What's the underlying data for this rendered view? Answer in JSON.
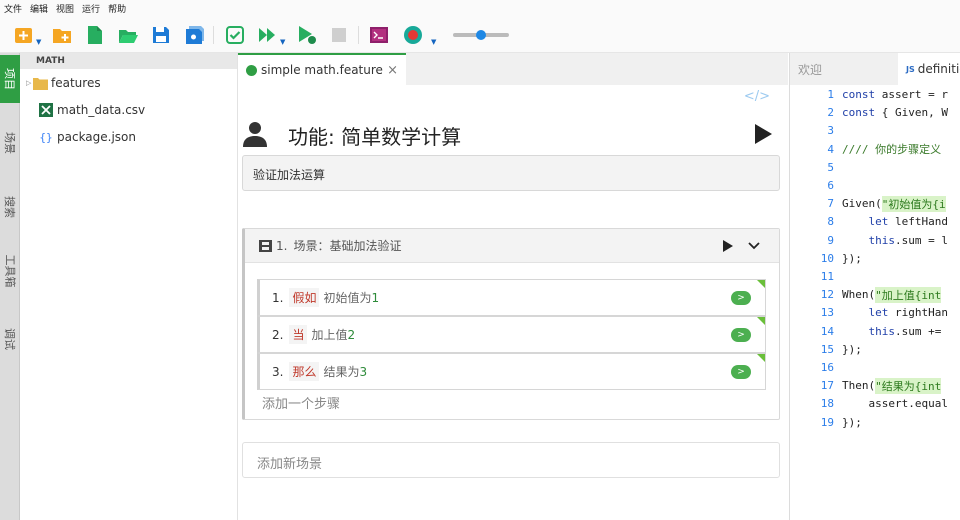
{
  "menu": [
    "文件",
    "编辑",
    "视图",
    "运行",
    "帮助"
  ],
  "toolbar": {
    "buttons": [
      "new-icon",
      "new-folder-icon",
      "new-file-icon",
      "open-folder-icon",
      "save-icon",
      "save-all-icon",
      "check-icon",
      "run-all-icon",
      "run-icon",
      "stop-icon",
      "terminal-icon",
      "record-icon"
    ],
    "slider_level": 0.5
  },
  "side_tabs": [
    "项目",
    "场景",
    "搜索",
    "工具箱",
    "调试"
  ],
  "explorer": {
    "title": "MATH",
    "items": [
      {
        "label": "features",
        "type": "folder"
      },
      {
        "label": "math_data.csv",
        "type": "excel"
      },
      {
        "label": "package.json",
        "type": "json"
      }
    ]
  },
  "editor_tab": {
    "label": "simple math.feature",
    "close": "×"
  },
  "code_toggle": "</>",
  "feature": {
    "title": "功能: 简单数学计算",
    "description": "验证加法运算"
  },
  "scenario": {
    "number": "1.",
    "title": "场景：基础加法验证",
    "steps": [
      {
        "num": "1.",
        "keyword": "假如",
        "text": "初始值为",
        "value": "1",
        "go": ">"
      },
      {
        "num": "2.",
        "keyword": "当",
        "text": "加上值",
        "value": "2",
        "go": ">"
      },
      {
        "num": "3.",
        "keyword": "那么",
        "text": "结果为",
        "value": "3",
        "go": ">"
      }
    ],
    "add_step": "添加一个步骤"
  },
  "add_scenario": "添加新场景",
  "right_tabs": {
    "welcome": "欢迎",
    "definitions_icon": "JS",
    "definitions": "definitions"
  },
  "code_lines": [
    {
      "n": "1",
      "parts": [
        {
          "t": "const",
          "c": "kwc"
        },
        {
          "t": " assert = r",
          "c": "ct"
        }
      ]
    },
    {
      "n": "2",
      "parts": [
        {
          "t": "const",
          "c": "kwc"
        },
        {
          "t": " { Given, W",
          "c": "ct"
        }
      ]
    },
    {
      "n": "3",
      "parts": []
    },
    {
      "n": "4",
      "parts": [
        {
          "t": "//// 你的步骤定义",
          "c": "cmt"
        }
      ]
    },
    {
      "n": "5",
      "parts": []
    },
    {
      "n": "6",
      "parts": []
    },
    {
      "n": "7",
      "parts": [
        {
          "t": "Given(",
          "c": "ct"
        },
        {
          "t": "\"初始值为{i",
          "c": "str"
        }
      ]
    },
    {
      "n": "8",
      "parts": [
        {
          "t": "    ",
          "c": "ct"
        },
        {
          "t": "let",
          "c": "kwc"
        },
        {
          "t": " leftHand",
          "c": "ct"
        }
      ]
    },
    {
      "n": "9",
      "parts": [
        {
          "t": "    ",
          "c": "ct"
        },
        {
          "t": "this",
          "c": "kwc"
        },
        {
          "t": ".sum = l",
          "c": "ct"
        }
      ]
    },
    {
      "n": "10",
      "parts": [
        {
          "t": "});",
          "c": "ct"
        }
      ]
    },
    {
      "n": "11",
      "parts": []
    },
    {
      "n": "12",
      "parts": [
        {
          "t": "When(",
          "c": "ct"
        },
        {
          "t": "\"加上值{int",
          "c": "str"
        }
      ]
    },
    {
      "n": "13",
      "parts": [
        {
          "t": "    ",
          "c": "ct"
        },
        {
          "t": "let",
          "c": "kwc"
        },
        {
          "t": " rightHan",
          "c": "ct"
        }
      ]
    },
    {
      "n": "14",
      "parts": [
        {
          "t": "    ",
          "c": "ct"
        },
        {
          "t": "this",
          "c": "kwc"
        },
        {
          "t": ".sum += ",
          "c": "ct"
        }
      ]
    },
    {
      "n": "15",
      "parts": [
        {
          "t": "});",
          "c": "ct"
        }
      ]
    },
    {
      "n": "16",
      "parts": []
    },
    {
      "n": "17",
      "parts": [
        {
          "t": "Then(",
          "c": "ct"
        },
        {
          "t": "\"结果为{int",
          "c": "str"
        }
      ]
    },
    {
      "n": "18",
      "parts": [
        {
          "t": "    assert.equal",
          "c": "ct"
        }
      ]
    },
    {
      "n": "19",
      "parts": [
        {
          "t": "});",
          "c": "ct"
        }
      ]
    }
  ],
  "colors": {
    "accent_green": "#2f9e44",
    "code_blue": "#2b7de9",
    "keyword_red": "#c0392b"
  }
}
